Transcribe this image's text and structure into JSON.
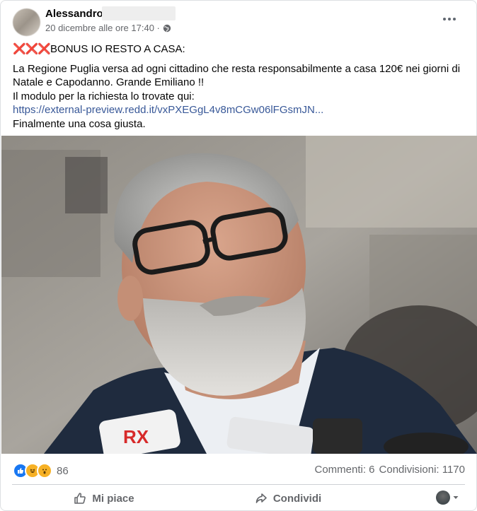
{
  "post": {
    "author": "Alessandro",
    "timestamp": "20 dicembre alle ore 17:40 ·",
    "privacy_icon": "globe-icon",
    "more_icon": "more-options-icon",
    "headline_marks": "❌❌❌",
    "headline": "BONUS IO RESTO A CASA:",
    "text_lines": [
      "La Regione Puglia versa ad ogni cittadino che resta responsabilmente a casa 120€ nei giorni di",
      "Natale e Capodanno. Grande Emiliano !!",
      "Il modulo per la richiesta lo trovate qui:"
    ],
    "link": "https://external-preview.redd.it/vxPXEGgL4v8mCGw06lFGsmJN...",
    "closing": "Finalmente  una cosa giusta."
  },
  "reactions": {
    "icons": [
      "like-reaction-icon",
      "haha-reaction-icon",
      "wow-reaction-icon"
    ],
    "count": "86"
  },
  "stats": {
    "comments": "Commenti: 6",
    "shares": "Condivisioni: 1170"
  },
  "actions": {
    "like": "Mi piace",
    "share": "Condividi"
  },
  "colors": {
    "accent_link": "#385898",
    "like_blue": "#1877f2",
    "muted": "#65676b"
  }
}
